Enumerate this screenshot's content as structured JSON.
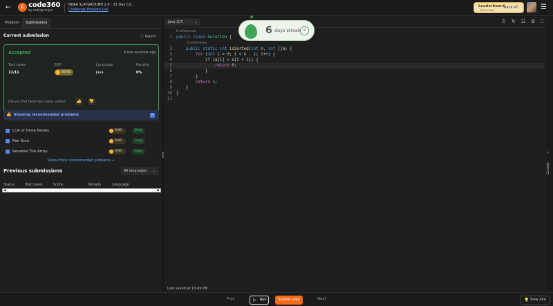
{
  "header": {
    "logo_brand": "code360",
    "logo_sub": "by coding ninjas",
    "event_title": "NINJA SLAYGROUND 2.0 : 21 Day Co...",
    "problem_list_link": "Challenge Problem List",
    "leaderboard_title": "Leaderboard",
    "leaderboard_dates": "(25-01 Dec)",
    "rank_label": "Rank 47"
  },
  "tabs": [
    {
      "label": "Problem"
    },
    {
      "label": "Submissions"
    }
  ],
  "submission": {
    "title": "Current submission",
    "report": "Report",
    "status": "Accepted",
    "time": "A few seconds ago",
    "labels": {
      "test_cases": "Test cases",
      "exp": "EXP",
      "language": "Language",
      "penalty": "Penalty"
    },
    "test_cases": "11/11",
    "exp": "40/40",
    "language": "Java",
    "penalty": "0%",
    "useful_question": "Did you find these test cases useful?"
  },
  "recommended": {
    "label": "Showing recommended problems",
    "problems": [
      {
        "name": "LCA of three Nodes",
        "exp": "0/40",
        "difficulty": "Easy"
      },
      {
        "name": "Pair Sum",
        "exp": "0/40",
        "difficulty": "Easy"
      },
      {
        "name": "Reverse The Array",
        "exp": "0/40",
        "difficulty": "Easy"
      }
    ],
    "show_more": "Show more recommended problems →"
  },
  "previous": {
    "title": "Previous submissions",
    "language_filter": "All languages",
    "columns": [
      "Status",
      "Test cases",
      "Score",
      "Penalty",
      "Language"
    ]
  },
  "editor": {
    "language": "Java (17)",
    "references_1": "0 references",
    "references_2": "0 references",
    "line_numbers": [
      "1",
      "2",
      "3",
      "4",
      "5",
      "6",
      "7",
      "8",
      "9",
      "10",
      "11"
    ],
    "last_saved": "Last saved at 10:49 PM"
  },
  "streak": {
    "count": "6",
    "label": "days streak",
    "badge": "9"
  },
  "console_label": "Console",
  "footer": {
    "prev": "Prev",
    "run": "Run",
    "submit": "Submit code",
    "next": "Next",
    "hint": "View hint"
  },
  "colors": {
    "accent": "#f26b1d",
    "accepted": "#4bd36b",
    "link": "#6aa7ff"
  }
}
